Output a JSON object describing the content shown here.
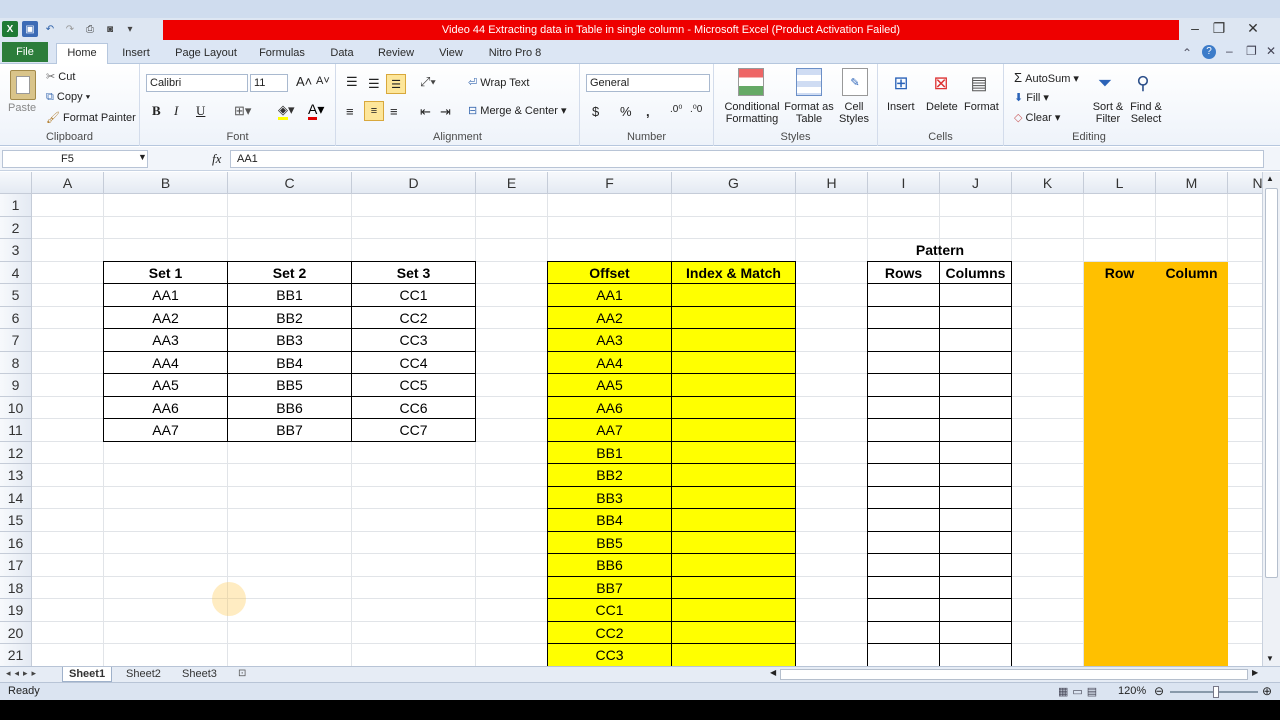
{
  "window": {
    "title": "Video 44 Extracting data in Table in single column  -  Microsoft Excel (Product Activation Failed)"
  },
  "tabs": [
    "File",
    "Home",
    "Insert",
    "Page Layout",
    "Formulas",
    "Data",
    "Review",
    "View",
    "Nitro Pro 8"
  ],
  "ribbon": {
    "clipboard": {
      "paste": "Paste",
      "cut": "Cut",
      "copy": "Copy",
      "format_painter": "Format Painter",
      "label": "Clipboard"
    },
    "font": {
      "name": "Calibri",
      "size": "11",
      "bold": "B",
      "italic": "I",
      "underline": "U",
      "label": "Font"
    },
    "alignment": {
      "wrap": "Wrap Text",
      "merge": "Merge & Center",
      "label": "Alignment"
    },
    "number": {
      "format": "General",
      "currency": "$",
      "percent": "%",
      "comma": ",",
      "label": "Number"
    },
    "styles": {
      "conditional": "Conditional Formatting",
      "format_table": "Format as Table",
      "cell_styles": "Cell Styles",
      "label": "Styles"
    },
    "cells": {
      "insert": "Insert",
      "delete": "Delete",
      "format": "Format",
      "label": "Cells"
    },
    "editing": {
      "autosum": "AutoSum",
      "fill": "Fill",
      "clear": "Clear",
      "sort": "Sort & Filter",
      "find": "Find & Select",
      "label": "Editing"
    }
  },
  "formula_bar": {
    "name_box": "F5",
    "fx": "fx",
    "value": "AA1"
  },
  "columns": [
    "A",
    "B",
    "C",
    "D",
    "E",
    "F",
    "G",
    "H",
    "I",
    "J",
    "K",
    "L",
    "M",
    "N"
  ],
  "rows": [
    "1",
    "2",
    "3",
    "4",
    "5",
    "6",
    "7",
    "8",
    "9",
    "10",
    "11",
    "12",
    "13",
    "14",
    "15",
    "16",
    "17",
    "18",
    "19",
    "20",
    "21"
  ],
  "table1": {
    "headers": [
      "Set 1",
      "Set 2",
      "Set 3"
    ],
    "rows": [
      [
        "AA1",
        "BB1",
        "CC1"
      ],
      [
        "AA2",
        "BB2",
        "CC2"
      ],
      [
        "AA3",
        "BB3",
        "CC3"
      ],
      [
        "AA4",
        "BB4",
        "CC4"
      ],
      [
        "AA5",
        "BB5",
        "CC5"
      ],
      [
        "AA6",
        "BB6",
        "CC6"
      ],
      [
        "AA7",
        "BB7",
        "CC7"
      ]
    ]
  },
  "table2": {
    "headers": [
      "Offset",
      "Index & Match"
    ],
    "offset_values": [
      "AA1",
      "AA2",
      "AA3",
      "AA4",
      "AA5",
      "AA6",
      "AA7",
      "BB1",
      "BB2",
      "BB3",
      "BB4",
      "BB5",
      "BB6",
      "BB7",
      "CC1",
      "CC2",
      "CC3"
    ]
  },
  "pattern": {
    "title": "Pattern",
    "headers": [
      "Rows",
      "Columns"
    ]
  },
  "rowcol": {
    "headers": [
      "Row",
      "Column"
    ]
  },
  "sheets": [
    "Sheet1",
    "Sheet2",
    "Sheet3"
  ],
  "status": {
    "ready": "Ready",
    "zoom": "120%"
  },
  "colors": {
    "yellow": "#ffff00",
    "orange": "#ffc000",
    "file_tab": "#2c7d3b",
    "title_red": "#ee0000"
  }
}
